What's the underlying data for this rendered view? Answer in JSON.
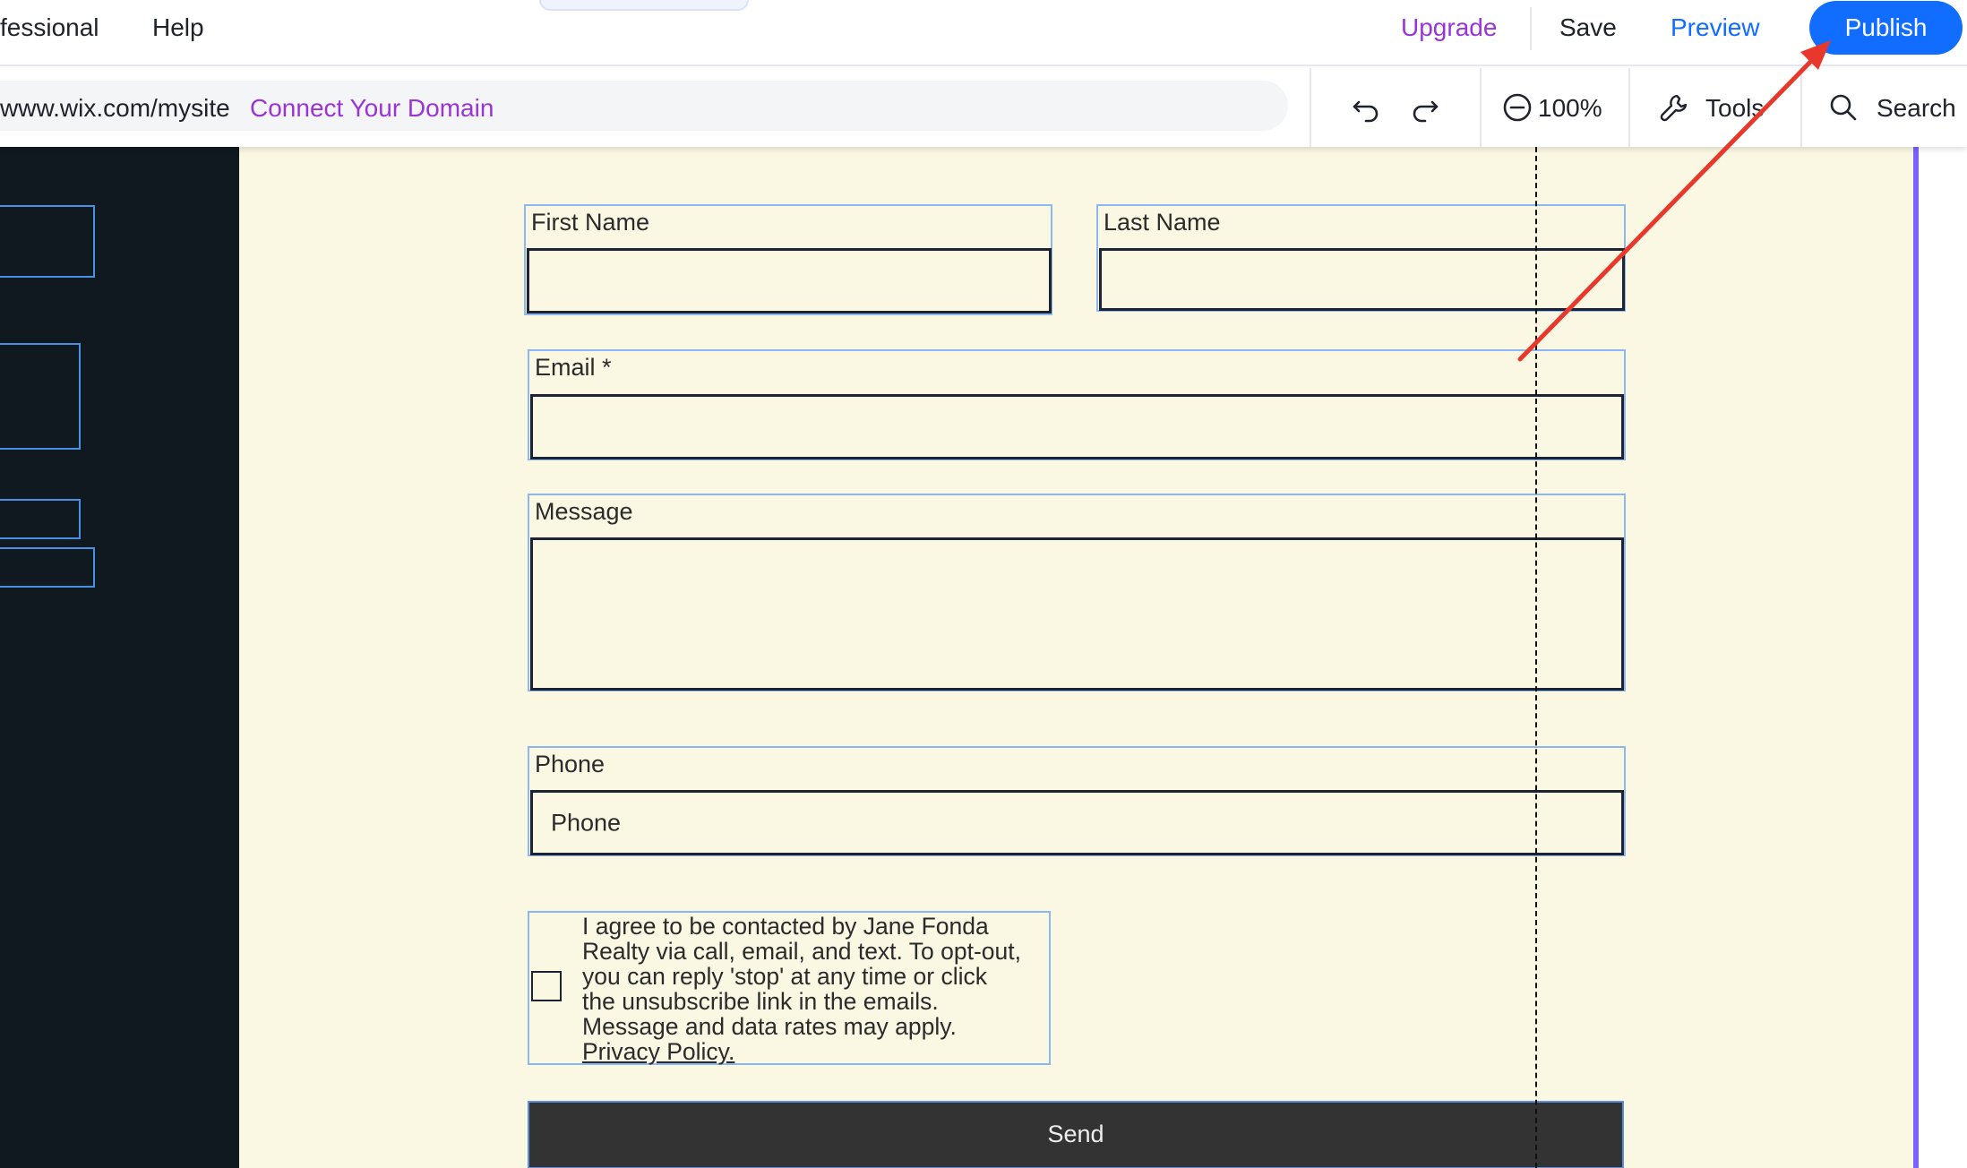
{
  "topbar": {
    "menu_items": [
      "fessional",
      "Help"
    ],
    "upgrade": "Upgrade",
    "save": "Save",
    "preview": "Preview",
    "publish": "Publish"
  },
  "addressbar": {
    "url": "www.wix.com/mysite",
    "connect_domain": "Connect Your Domain"
  },
  "toolbar": {
    "undo_icon": "undo-icon",
    "redo_icon": "redo-icon",
    "zoom": "100%",
    "tools": "Tools",
    "search": "Search"
  },
  "form": {
    "first_name_label": "First Name",
    "last_name_label": "Last Name",
    "email_label": "Email *",
    "message_label": "Message",
    "phone_label": "Phone",
    "phone_placeholder": "Phone",
    "consent_lines": [
      "I agree to be contacted by Jane Fonda",
      "Realty via call, email, and text. To opt-out,",
      "you can reply 'stop' at any time or click",
      "the unsubscribe link in the emails.",
      "Message and data rates may apply."
    ],
    "privacy_link": "Privacy Policy.",
    "send": "Send"
  },
  "colors": {
    "publish_blue": "#116dff",
    "upgrade_purple": "#9b34d6",
    "canvas_bg": "#faf7e2",
    "panel_dark": "#101820",
    "selection_blue": "#8db7f0",
    "arrow_red": "#e8382b",
    "send_bg": "#333333"
  }
}
